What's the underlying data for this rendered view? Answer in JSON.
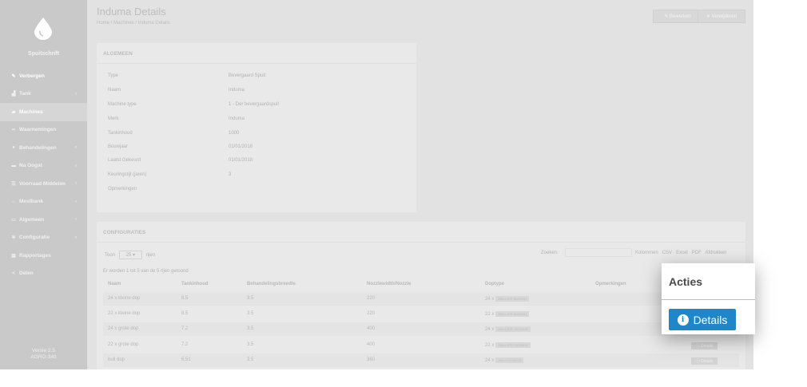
{
  "sidebar": {
    "brand": "Spuitschrift",
    "items": [
      {
        "label": "Verbergen",
        "icon": "pencil-icon",
        "chevron": false
      },
      {
        "label": "Tank",
        "icon": "chart-icon",
        "chevron": true
      },
      {
        "label": "Machines",
        "icon": "truck-icon",
        "chevron": false
      },
      {
        "label": "Waarnemingen",
        "icon": "binoculars-icon",
        "chevron": false
      },
      {
        "label": "Behandelingen",
        "icon": "drop-icon",
        "chevron": true
      },
      {
        "label": "Na Oogst",
        "icon": "box-icon",
        "chevron": true
      },
      {
        "label": "Voorraad Middelen",
        "icon": "list-icon",
        "chevron": true
      },
      {
        "label": "Mestbank",
        "icon": "bank-icon",
        "chevron": true
      },
      {
        "label": "Algemeen",
        "icon": "folder-icon",
        "chevron": true
      },
      {
        "label": "Configuratie",
        "icon": "gear-icon",
        "chevron": true
      },
      {
        "label": "Rapportages",
        "icon": "file-icon",
        "chevron": false
      },
      {
        "label": "Delen",
        "icon": "share-icon",
        "chevron": false
      }
    ],
    "version_line1": "Versie 2.5",
    "version_line2": "AGRO-348"
  },
  "header": {
    "title": "Induma Details",
    "breadcrumb": "Home / Machines / Induma Details",
    "edit_label": "Bewerken",
    "delete_label": "Verwijderen"
  },
  "general": {
    "title": "ALGEMEEN",
    "rows": [
      {
        "key": "Type",
        "value": "Bevergaard Spuit"
      },
      {
        "key": "Naam",
        "value": "Induma"
      },
      {
        "key": "Machine type",
        "value": "1 - Der bevergaardspuit"
      },
      {
        "key": "Merk",
        "value": "Induma"
      },
      {
        "key": "Tankinhoud",
        "value": "1000"
      },
      {
        "key": "Bouwjaar",
        "value": "01/01/2018"
      },
      {
        "key": "Laatst Gekeurd",
        "value": "01/01/2018"
      },
      {
        "key": "Keuringstijl (jaren)",
        "value": "3"
      },
      {
        "key": "Opmerkingen",
        "value": ""
      }
    ]
  },
  "config": {
    "title": "CONFIGURATIES",
    "show_label": "Toon",
    "show_value": "25",
    "rows_label": "rijen",
    "search_label": "Zoeken:",
    "export_buttons": [
      "Kolommen",
      "CSV",
      "Excel",
      "PDF",
      "Afdrukken"
    ],
    "info": "Er worden 1 tot 5 van de 5 rijen getoond",
    "headers": [
      "Naam",
      "Tankinhoud",
      "Behandelingsbreedte",
      "Nozzlewidth/Nozzle",
      "Doptype",
      "Opmerkingen"
    ],
    "rows": [
      {
        "name": "24 x kleine dop",
        "tank": "8.5",
        "width": "3.5",
        "nozzle": "220",
        "dop": "24 x",
        "tag": "Albuz ATR 80/03HN"
      },
      {
        "name": "22 x kleine dop",
        "tank": "8.5",
        "width": "3.5",
        "nozzle": "220",
        "dop": "22 x",
        "tag": "Albuz ATR 80/03HN"
      },
      {
        "name": "24 x grote dop",
        "tank": "7.2",
        "width": "3.5",
        "nozzle": "400",
        "dop": "24 x",
        "tag": "Albuz ATR 100/06HE"
      },
      {
        "name": "22 x grote dop",
        "tank": "7.2",
        "width": "3.5",
        "nozzle": "400",
        "dop": "22 x",
        "tag": "Albuz ATR 100/06HE"
      },
      {
        "name": "bull dop",
        "tank": "6.51",
        "width": "3.5",
        "nozzle": "360",
        "dop": "24 x",
        "tag": "Albuz TVI 80-03"
      }
    ],
    "row_button_label": "Details"
  },
  "popup": {
    "title": "Acties",
    "button_label": "Details",
    "button_color": "#1f87c9"
  }
}
